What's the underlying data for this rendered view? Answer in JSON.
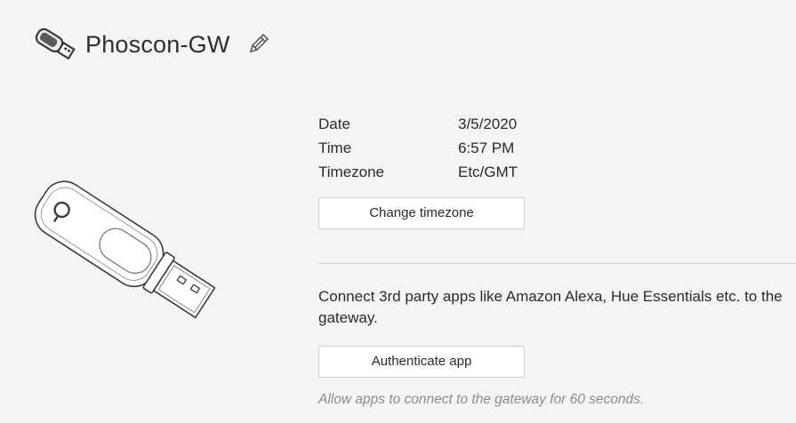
{
  "header": {
    "title": "Phoscon-GW",
    "device_icon": "usb-stick-icon",
    "edit_icon": "pencil-icon"
  },
  "device_image": "usb-gateway-illustration",
  "info": {
    "rows": [
      {
        "label": "Date",
        "value": "3/5/2020"
      },
      {
        "label": "Time",
        "value": "6:57 PM"
      },
      {
        "label": "Timezone",
        "value": "Etc/GMT"
      }
    ]
  },
  "buttons": {
    "change_timezone": "Change timezone",
    "authenticate_app": "Authenticate app"
  },
  "connect": {
    "text": "Connect 3rd party apps like Amazon Alexa, Hue Essentials etc. to the gateway.",
    "hint": "Allow apps to connect to the gateway for 60 seconds."
  },
  "colors": {
    "background": "#f4f4f4",
    "text": "#2b2b2b",
    "muted": "#8c8c8c",
    "divider": "#d2d2d2"
  }
}
